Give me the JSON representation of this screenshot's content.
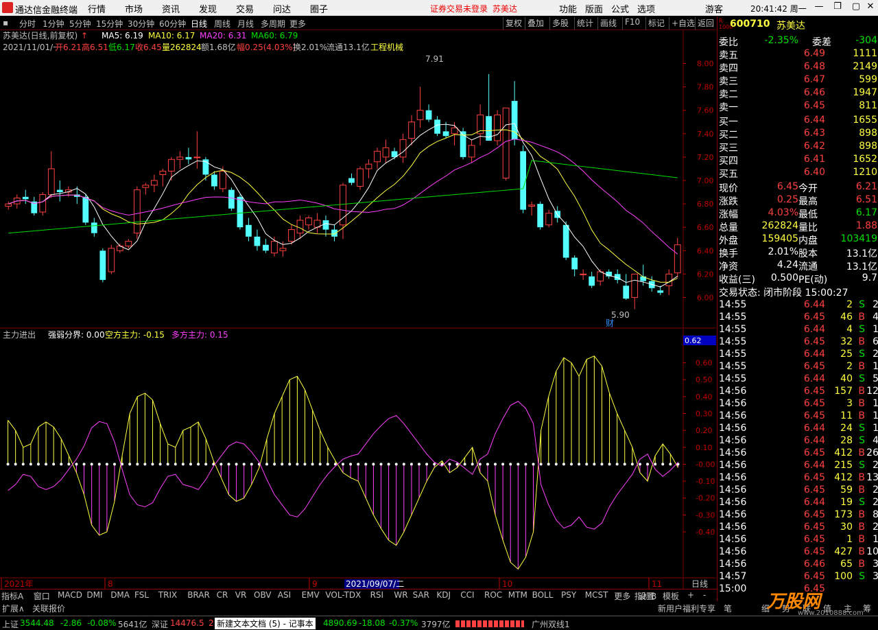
{
  "menubar": {
    "app_title": "通达信金融终端",
    "menus": [
      "行情",
      "市场",
      "资讯",
      "发现",
      "交易",
      "问达",
      "圈子"
    ],
    "warning": "证券交易未登录",
    "warning_stock": "苏美达",
    "right_menus": [
      "功能",
      "版面",
      "公式",
      "选项"
    ],
    "user": "游客",
    "time": "20:41:42 周一"
  },
  "toolbar": {
    "periods": [
      "分时",
      "1分钟",
      "5分钟",
      "15分钟",
      "30分钟",
      "60分钟",
      "日线",
      "周线",
      "月线",
      "多周期",
      "更多"
    ],
    "active_period": "日线",
    "right_buttons": [
      "复权",
      "叠加",
      "多股",
      "统计",
      "画线",
      "F10",
      "标记",
      "+自选",
      "返回"
    ]
  },
  "chart_header": {
    "name": "苏美达(日线,前复权)",
    "ma5": "MA5: 6.19",
    "ma10": "MA10: 6.17",
    "ma20": "MA20: 6.31",
    "ma60": "MA60: 6.79",
    "date": "2021/11/01/一",
    "open": "开6.21",
    "high": "高6.51",
    "low": "低6.17",
    "close": "收6.45",
    "volume": "量262824",
    "amount": "额1.68亿",
    "range": "幅0.25(4.03%)",
    "turnover": "换2.01%",
    "float": "流通13.1亿",
    "industry": "工程机械",
    "hi_marker": "7.91",
    "lo_marker": "5.90",
    "finance_marker": "财"
  },
  "indicator_header": {
    "name": "主力进出",
    "line1": "强弱分界: 0.00",
    "line2": "空方主力: -0.15",
    "line3": "多方主力: 0.15",
    "current": "0.62"
  },
  "price_axis": [
    "8.00",
    "7.80",
    "7.60",
    "7.40",
    "7.20",
    "7.00",
    "6.80",
    "6.60",
    "6.40",
    "6.20",
    "6.00"
  ],
  "ind_axis": [
    "0.60",
    "0.50",
    "0.40",
    "0.30",
    "0.20",
    "0.10",
    "-0.00",
    "-0.10",
    "-0.20",
    "-0.30",
    "-0.40"
  ],
  "date_axis": [
    "2021年",
    "8",
    "9",
    "10",
    "11"
  ],
  "date_cursor": "2021/09/07/二",
  "date_type": "日线",
  "chart_data": {
    "type": "candlestick",
    "ylim": [
      5.85,
      8.05
    ],
    "candles": [
      [
        6.78,
        6.82,
        6.75,
        6.8
      ],
      [
        6.8,
        6.88,
        6.76,
        6.85
      ],
      [
        6.86,
        6.92,
        6.8,
        6.84
      ],
      [
        6.82,
        6.86,
        6.7,
        6.72
      ],
      [
        6.73,
        6.9,
        6.7,
        6.88
      ],
      [
        6.88,
        7.25,
        6.85,
        7.1
      ],
      [
        6.92,
        7.0,
        6.82,
        6.9
      ],
      [
        6.9,
        6.95,
        6.86,
        6.92
      ],
      [
        6.88,
        6.95,
        6.8,
        6.86
      ],
      [
        6.86,
        6.88,
        6.62,
        6.64
      ],
      [
        6.64,
        6.68,
        6.52,
        6.55
      ],
      [
        6.4,
        6.42,
        6.13,
        6.15
      ],
      [
        6.22,
        6.45,
        6.2,
        6.42
      ],
      [
        6.4,
        6.46,
        6.38,
        6.44
      ],
      [
        6.44,
        6.5,
        6.42,
        6.48
      ],
      [
        6.55,
        6.95,
        6.5,
        6.92
      ],
      [
        6.94,
        6.98,
        6.88,
        6.96
      ],
      [
        6.96,
        7.05,
        6.9,
        7.0
      ],
      [
        7.05,
        7.1,
        6.95,
        7.08
      ],
      [
        7.08,
        7.2,
        7.0,
        7.18
      ],
      [
        7.18,
        7.25,
        7.1,
        7.2
      ],
      [
        7.2,
        7.28,
        7.14,
        7.18
      ],
      [
        7.2,
        7.42,
        7.1,
        7.2
      ],
      [
        7.18,
        7.2,
        7.0,
        7.05
      ],
      [
        7.05,
        7.08,
        6.92,
        6.95
      ],
      [
        6.93,
        7.12,
        6.9,
        7.08
      ],
      [
        6.92,
        6.94,
        6.74,
        6.76
      ],
      [
        6.86,
        6.88,
        6.58,
        6.6
      ],
      [
        6.62,
        6.68,
        6.48,
        6.52
      ],
      [
        6.52,
        6.58,
        6.4,
        6.44
      ],
      [
        6.45,
        6.5,
        6.38,
        6.4
      ],
      [
        6.38,
        6.52,
        6.35,
        6.48
      ],
      [
        6.4,
        6.48,
        6.35,
        6.42
      ],
      [
        6.48,
        6.62,
        6.45,
        6.58
      ],
      [
        6.55,
        6.7,
        6.5,
        6.66
      ],
      [
        6.62,
        6.7,
        6.58,
        6.68
      ],
      [
        6.6,
        6.72,
        6.55,
        6.66
      ],
      [
        6.66,
        6.7,
        6.52,
        6.58
      ],
      [
        6.58,
        6.62,
        6.48,
        6.52
      ],
      [
        6.62,
        6.98,
        6.5,
        6.96
      ],
      [
        7.02,
        7.06,
        6.96,
        6.98
      ],
      [
        6.95,
        7.12,
        6.92,
        7.1
      ],
      [
        7.1,
        7.18,
        7.02,
        7.14
      ],
      [
        7.16,
        7.28,
        7.1,
        7.25
      ],
      [
        7.2,
        7.35,
        7.15,
        7.28
      ],
      [
        7.25,
        7.28,
        7.18,
        7.2
      ],
      [
        7.2,
        7.4,
        7.15,
        7.35
      ],
      [
        7.36,
        7.56,
        7.3,
        7.5
      ],
      [
        7.52,
        7.8,
        7.45,
        7.6
      ],
      [
        7.6,
        7.65,
        7.5,
        7.52
      ],
      [
        7.52,
        7.55,
        7.38,
        7.4
      ],
      [
        7.42,
        7.5,
        7.36,
        7.38
      ],
      [
        7.4,
        7.5,
        7.3,
        7.45
      ],
      [
        7.42,
        7.45,
        7.18,
        7.2
      ],
      [
        7.2,
        7.35,
        7.15,
        7.3
      ],
      [
        7.4,
        7.65,
        7.3,
        7.56
      ],
      [
        7.55,
        7.91,
        7.35,
        7.34
      ],
      [
        7.34,
        7.6,
        7.3,
        7.56
      ],
      [
        7.02,
        7.6,
        7.0,
        7.62
      ],
      [
        7.68,
        7.85,
        7.3,
        7.35
      ],
      [
        7.25,
        7.3,
        6.72,
        6.75
      ],
      [
        6.78,
        6.82,
        6.7,
        6.79
      ],
      [
        6.8,
        6.82,
        6.58,
        6.6
      ],
      [
        6.62,
        6.75,
        6.6,
        6.72
      ],
      [
        6.74,
        6.78,
        6.64,
        6.68
      ],
      [
        6.62,
        6.65,
        6.32,
        6.34
      ],
      [
        6.34,
        6.36,
        6.18,
        6.24
      ],
      [
        6.2,
        6.24,
        6.15,
        6.2
      ],
      [
        6.18,
        6.22,
        6.08,
        6.1
      ],
      [
        6.14,
        6.24,
        6.1,
        6.22
      ],
      [
        6.22,
        6.24,
        6.16,
        6.18
      ],
      [
        6.2,
        6.24,
        6.12,
        6.15
      ],
      [
        6.1,
        6.2,
        5.98,
        5.99
      ],
      [
        6.0,
        6.2,
        5.9,
        6.2
      ],
      [
        6.18,
        6.28,
        6.1,
        6.14
      ],
      [
        6.14,
        6.18,
        6.05,
        6.08
      ],
      [
        6.06,
        6.1,
        6.02,
        6.04
      ],
      [
        6.1,
        6.24,
        6.02,
        6.2
      ],
      [
        6.21,
        6.51,
        6.17,
        6.45
      ]
    ],
    "indicator_series": [
      0.26,
      0.2,
      0.1,
      0.12,
      0.22,
      0.25,
      0.22,
      0.15,
      0.05,
      -0.05,
      -0.18,
      -0.36,
      -0.42,
      -0.4,
      -0.22,
      0.05,
      0.3,
      0.4,
      0.42,
      0.38,
      0.24,
      0.12,
      0.1,
      0.2,
      0.22,
      0.25,
      0.15,
      0.02,
      -0.08,
      -0.18,
      -0.22,
      -0.2,
      -0.12,
      -0.02,
      0.15,
      0.3,
      0.4,
      0.5,
      0.52,
      0.44,
      0.32,
      0.2,
      0.1,
      0.02,
      -0.05,
      -0.08,
      -0.1,
      -0.2,
      -0.3,
      -0.38,
      -0.45,
      -0.48,
      -0.4,
      -0.3,
      -0.2,
      -0.1,
      -0.02,
      0.02,
      -0.05,
      -0.02,
      0.04,
      0.1,
      -0.05,
      -0.1,
      -0.3,
      -0.45,
      -0.58,
      -0.62,
      -0.55,
      -0.4,
      0.2,
      0.4,
      0.55,
      0.63,
      0.6,
      0.52,
      0.62,
      0.64,
      0.58,
      0.42,
      0.3,
      0.2,
      0.1,
      -0.05,
      -0.1,
      0.05,
      0.12,
      0.06,
      -0.02
    ]
  },
  "quote": {
    "code": "600710",
    "name": "苏美达",
    "weibi_label": "委比",
    "weibi": "-2.35%",
    "weicha_label": "委差",
    "weicha": "-304",
    "asks": [
      [
        "卖五",
        "6.49",
        "1111"
      ],
      [
        "卖四",
        "6.48",
        "2149"
      ],
      [
        "卖三",
        "6.47",
        "599"
      ],
      [
        "卖二",
        "6.46",
        "1947"
      ],
      [
        "卖一",
        "6.45",
        "811"
      ]
    ],
    "bids": [
      [
        "买一",
        "6.44",
        "1655"
      ],
      [
        "买二",
        "6.43",
        "898"
      ],
      [
        "买三",
        "6.42",
        "898"
      ],
      [
        "买四",
        "6.41",
        "1652"
      ],
      [
        "买五",
        "6.40",
        "1210"
      ]
    ],
    "stats": [
      [
        "现价",
        "6.45",
        "今开",
        "6.21"
      ],
      [
        "涨跌",
        "0.25",
        "最高",
        "6.51"
      ],
      [
        "涨幅",
        "4.03%",
        "最低",
        "6.17"
      ],
      [
        "总量",
        "262824",
        "量比",
        "1.88"
      ],
      [
        "外盘",
        "159405",
        "内盘",
        "103419"
      ],
      [
        "换手",
        "2.01%",
        "股本",
        "13.1亿"
      ],
      [
        "净资",
        "4.24",
        "流通",
        "13.1亿"
      ],
      [
        "收益(三)",
        "0.500",
        "PE(动)",
        "9.7"
      ]
    ],
    "trade_state": "交易状态: 闭市阶段 15:00:27",
    "ticks": [
      [
        "14:55",
        "6.44",
        "2",
        "S",
        "2"
      ],
      [
        "14:55",
        "6.45",
        "46",
        "B",
        "4"
      ],
      [
        "14:55",
        "6.44",
        "4",
        "S",
        "1"
      ],
      [
        "14:55",
        "6.45",
        "32",
        "B",
        "6"
      ],
      [
        "14:55",
        "6.44",
        "25",
        "S",
        "2"
      ],
      [
        "14:55",
        "6.45",
        "2",
        "B",
        "1"
      ],
      [
        "14:55",
        "6.44",
        "40",
        "S",
        "5"
      ],
      [
        "14:56",
        "6.45",
        "157",
        "B",
        "12"
      ],
      [
        "14:56",
        "6.45",
        "3",
        "B",
        "1"
      ],
      [
        "14:56",
        "6.45",
        "11",
        "B",
        "1"
      ],
      [
        "14:56",
        "6.44",
        "24",
        "S",
        "1"
      ],
      [
        "14:56",
        "6.44",
        "28",
        "S",
        "4"
      ],
      [
        "14:56",
        "6.45",
        "412",
        "B",
        "26"
      ],
      [
        "14:56",
        "6.44",
        "215",
        "S",
        "2"
      ],
      [
        "14:56",
        "6.45",
        "412",
        "B",
        "13"
      ],
      [
        "14:56",
        "6.45",
        "59",
        "B",
        "2"
      ],
      [
        "14:56",
        "6.44",
        "19",
        "S",
        "2"
      ],
      [
        "14:56",
        "6.45",
        "173",
        "B",
        "8"
      ],
      [
        "14:56",
        "6.45",
        "30",
        "B",
        "2"
      ],
      [
        "14:56",
        "6.45",
        "1",
        "B",
        "1"
      ],
      [
        "14:56",
        "6.45",
        "427",
        "B",
        "10"
      ],
      [
        "14:56",
        "6.46",
        "65",
        "B",
        "3"
      ],
      [
        "14:57",
        "6.45",
        "100",
        "S",
        "3"
      ],
      [
        "15:00",
        "6.45",
        "",
        "",
        ""
      ]
    ]
  },
  "bottom_tabs": [
    "指标A",
    "窗口",
    "MACD",
    "DMI",
    "DMA",
    "FSL",
    "TRIX",
    "BRAR",
    "CR",
    "VR",
    "OBV",
    "ASI",
    "EMV",
    "VOL-TDX",
    "RSI",
    "WR",
    "SAR",
    "KDJ",
    "CCI",
    "ROC",
    "MTM",
    "BOLL",
    "PSY",
    "MCST",
    "更多",
    "设置"
  ],
  "bottom_right": [
    "指标B",
    "模板",
    "+",
    "-"
  ],
  "bar2": {
    "left": [
      "扩展∧",
      "关联报价"
    ],
    "right": "新用户福利专享",
    "right_tabs": [
      "笔",
      "细",
      "势",
      "联",
      "值",
      "主",
      "筹"
    ]
  },
  "status": {
    "sh_label": "上证",
    "sh_val": "3544.48",
    "sh_chg": "-2.86",
    "sh_pct": "-0.08%",
    "sh_amt": "5641亿",
    "sz_label": "深证",
    "sz_val": "14476.5",
    "sz_chg": "2",
    "popup": "新建文本文档 (5) - 记事本",
    "cy_val": "4890.69",
    "cy_chg": "-18.08",
    "cy_pct": "-0.37%",
    "cy_amt": "3797亿",
    "news": "广州双线1",
    "watermark": "万股网",
    "watermark_url": "www.2010888.com"
  },
  "colors": {
    "up": "#ff4040",
    "down": "#54ffff",
    "ma5": "#ffffff",
    "ma10": "#ffff40",
    "ma20": "#ff40ff",
    "ma60": "#00e000",
    "grid": "#800000"
  }
}
